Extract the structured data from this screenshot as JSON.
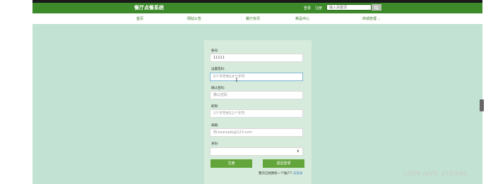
{
  "header": {
    "title": "餐厅点餐系统",
    "login": "登录",
    "register": "注册",
    "search_placeholder": "输入关键词"
  },
  "nav": {
    "items": [
      "首页",
      "网站公告",
      "餐厅资讯",
      "菜品中心",
      "商城管理 ⌄"
    ]
  },
  "form": {
    "account_label": "账号:",
    "account_value": "11111",
    "password_label": "设置密码:",
    "password_placeholder": "6个字符到16个字符",
    "confirm_label": "确认密码:",
    "confirm_placeholder": "确认密码",
    "nickname_label": "昵称:",
    "nickname_placeholder": "2个字符到12个字符",
    "email_label": "邮箱:",
    "email_placeholder": "例:example@123.com",
    "identity_label": "身份:",
    "identity_value": "",
    "register_button": "注册",
    "back_button": "返回登录",
    "footer_text": "整页已经拥有一个账户?",
    "footer_link": "去登录"
  },
  "watermark": "CSDN @VX_ZYKJ985",
  "colors": {
    "header": "#3d8a2a",
    "background": "#c2e3d3",
    "button": "#63a53a",
    "nav_text": "#3a7a2a"
  }
}
